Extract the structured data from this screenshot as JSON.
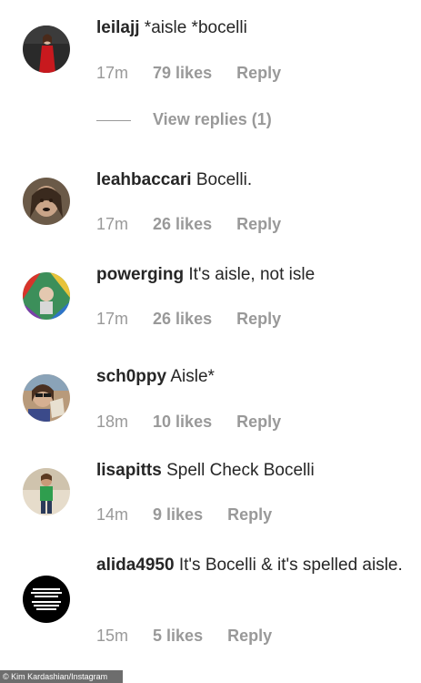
{
  "comments": [
    {
      "username": "leilajj",
      "text": " *aisle *bocelli",
      "time": "17m",
      "likes": "79 likes",
      "reply": "Reply",
      "view_replies": "View replies (1)"
    },
    {
      "username": "leahbaccari",
      "text": " Bocelli.",
      "time": "17m",
      "likes": "26 likes",
      "reply": "Reply"
    },
    {
      "username": "powerging",
      "text": " It's aisle, not isle",
      "time": "17m",
      "likes": "26 likes",
      "reply": "Reply"
    },
    {
      "username": "sch0ppy",
      "text": " Aisle*",
      "time": "18m",
      "likes": "10 likes",
      "reply": "Reply"
    },
    {
      "username": "lisapitts",
      "text": " Spell Check Bocelli",
      "time": "14m",
      "likes": "9 likes",
      "reply": "Reply"
    },
    {
      "username": "alida4950",
      "text": " It's Bocelli & it's spelled aisle.",
      "time": "15m",
      "likes": "5 likes",
      "reply": "Reply"
    }
  ],
  "credit": "© Kim Kardashian/Instagram",
  "colors": {
    "text": "#262626",
    "meta": "#999999",
    "credit_bg": "#6d6d6d"
  }
}
